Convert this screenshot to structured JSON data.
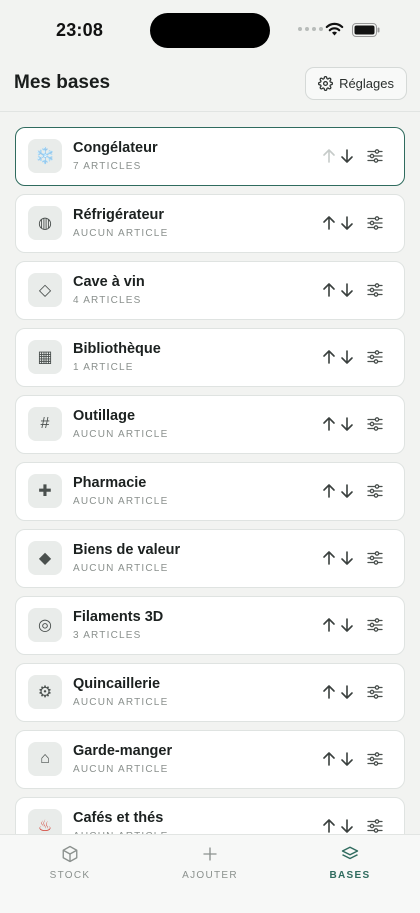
{
  "status_bar": {
    "time": "23:08"
  },
  "header": {
    "title": "Mes bases",
    "settings_label": "Réglages"
  },
  "bases": [
    {
      "name": "Congélateur",
      "count": "7 ARTICLES",
      "icon": "snowflake-icon",
      "glyph": "❄️",
      "active": true,
      "up_disabled": true
    },
    {
      "name": "Réfrigérateur",
      "count": "AUCUN ARTICLE",
      "icon": "fridge-icon",
      "glyph": "◍"
    },
    {
      "name": "Cave à vin",
      "count": "4 ARTICLES",
      "icon": "diamond-outline-icon",
      "glyph": "◇"
    },
    {
      "name": "Bibliothèque",
      "count": "1 ARTICLE",
      "icon": "book-square-icon",
      "glyph": "▦"
    },
    {
      "name": "Outillage",
      "count": "AUCUN ARTICLE",
      "icon": "hash-icon",
      "glyph": "#"
    },
    {
      "name": "Pharmacie",
      "count": "AUCUN ARTICLE",
      "icon": "cross-icon",
      "glyph": "✚"
    },
    {
      "name": "Biens de valeur",
      "count": "AUCUN ARTICLE",
      "icon": "diamond-filled-icon",
      "glyph": "◆"
    },
    {
      "name": "Filaments 3D",
      "count": "3 ARTICLES",
      "icon": "spool-icon",
      "glyph": "◎"
    },
    {
      "name": "Quincaillerie",
      "count": "AUCUN ARTICLE",
      "icon": "gear-bolt-icon",
      "glyph": "⚙"
    },
    {
      "name": "Garde-manger",
      "count": "AUCUN ARTICLE",
      "icon": "house-icon",
      "glyph": "⌂"
    },
    {
      "name": "Cafés et thés",
      "count": "AUCUN ARTICLE",
      "icon": "hot-drink-icon",
      "glyph": "♨"
    }
  ],
  "tabs": [
    {
      "label": "STOCK",
      "icon": "box-icon"
    },
    {
      "label": "AJOUTER",
      "icon": "plus-icon"
    },
    {
      "label": "BASES",
      "icon": "layers-icon",
      "active": true
    }
  ],
  "colors": {
    "accent": "#2f6b5e",
    "hot_drink": "#d23b2f"
  }
}
